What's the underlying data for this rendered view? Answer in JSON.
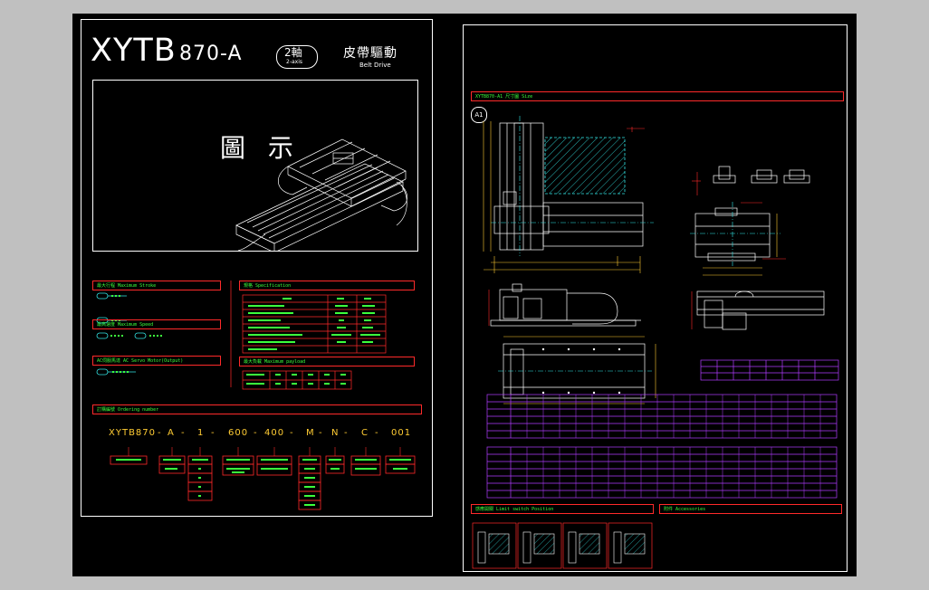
{
  "left_sheet": {
    "title_main": "XYTB",
    "title_model": "870-A",
    "axis_badge": "2軸",
    "axis_sub": "2-axis",
    "drive_cn": "皮帶驅動",
    "drive_en": "Belt Drive",
    "figure_label": "圖 示",
    "sections": {
      "max_stroke": "最大行程 Maximum Stroke",
      "max_speed": "最高速度 Maximum Speed",
      "ac_servo": "AC伺服馬達 AC Servo Motor(Output)",
      "specification": "規格 Specification",
      "max_payload": "最大負載 Maximum payload",
      "ordering": "訂購編號 Ordering number"
    },
    "order_code": {
      "series": "XYTB870",
      "parts": [
        "A",
        "1",
        "600",
        "400",
        "M",
        "N",
        "C",
        "001"
      ]
    }
  },
  "right_sheet": {
    "header": "XYTB870-A1 尺寸圖 Size",
    "view_label": "A1",
    "section_limit_switch": "感應開關 Limit switch Position",
    "section_accessories": "附件 Accessories"
  },
  "colors": {
    "canvas": "#000000",
    "frame": "#c0c0c0",
    "line_white": "#ffffff",
    "line_red": "#ff2a2a",
    "text_green": "#3cff3c",
    "text_yellow": "#ffcc33",
    "line_cyan": "#33e6e6",
    "grid_magenta": "#b13cff"
  }
}
